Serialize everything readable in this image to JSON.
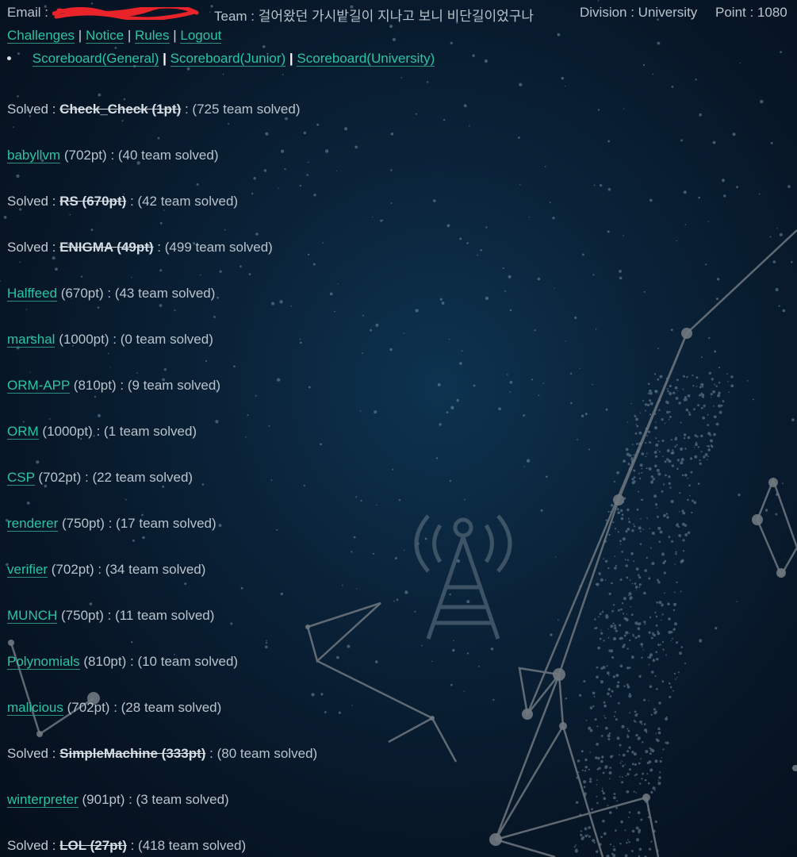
{
  "header": {
    "email_label": "Email :",
    "team": "Team : 걸어왔던 가시밭길이 지나고 보니 비단길이었구나",
    "division": "Division : University",
    "point": "Point : 1080"
  },
  "nav": {
    "items": [
      "Challenges",
      "Notice",
      "Rules",
      "Logout"
    ],
    "separator": "|"
  },
  "scoreboards": {
    "items": [
      "Scoreboard(General)",
      "Scoreboard(Junior)",
      "Scoreboard(University)"
    ],
    "separator": "|"
  },
  "solved_prefix": "Solved :",
  "challenges": [
    {
      "solved": true,
      "name": "Check_Check",
      "points": "(1pt)",
      "count": ": (725 team solved)"
    },
    {
      "solved": false,
      "name": "babyllvm",
      "points": "(702pt)",
      "count": ": (40 team solved)"
    },
    {
      "solved": true,
      "name": "RS",
      "points": "(670pt)",
      "count": ": (42 team solved)"
    },
    {
      "solved": true,
      "name": "ENIGMA",
      "points": "(49pt)",
      "count": ": (499 team solved)"
    },
    {
      "solved": false,
      "name": "Halffeed",
      "points": "(670pt)",
      "count": ": (43 team solved)"
    },
    {
      "solved": false,
      "name": "marshal",
      "points": "(1000pt)",
      "count": ": (0 team solved)"
    },
    {
      "solved": false,
      "name": "ORM-APP",
      "points": "(810pt)",
      "count": ": (9 team solved)"
    },
    {
      "solved": false,
      "name": "ORM",
      "points": "(1000pt)",
      "count": ": (1 team solved)"
    },
    {
      "solved": false,
      "name": "CSP",
      "points": "(702pt)",
      "count": ": (22 team solved)"
    },
    {
      "solved": false,
      "name": "renderer",
      "points": "(750pt)",
      "count": ": (17 team solved)"
    },
    {
      "solved": false,
      "name": "verifier",
      "points": "(702pt)",
      "count": ": (34 team solved)"
    },
    {
      "solved": false,
      "name": "MUNCH",
      "points": "(750pt)",
      "count": ": (11 team solved)"
    },
    {
      "solved": false,
      "name": "Polynomials",
      "points": "(810pt)",
      "count": ": (10 team solved)"
    },
    {
      "solved": false,
      "name": "malicious",
      "points": "(702pt)",
      "count": ": (28 team solved)"
    },
    {
      "solved": true,
      "name": "SimpleMachine",
      "points": "(333pt)",
      "count": ": (80 team solved)"
    },
    {
      "solved": false,
      "name": "winterpreter",
      "points": "(901pt)",
      "count": ": (3 team solved)"
    },
    {
      "solved": true,
      "name": "LOL",
      "points": "(27pt)",
      "count": ": (418 team solved)"
    }
  ],
  "colors": {
    "link": "#2bc4a4",
    "text": "#b9c3cc",
    "background": "#0a2238",
    "redaction": "#e8232a"
  }
}
